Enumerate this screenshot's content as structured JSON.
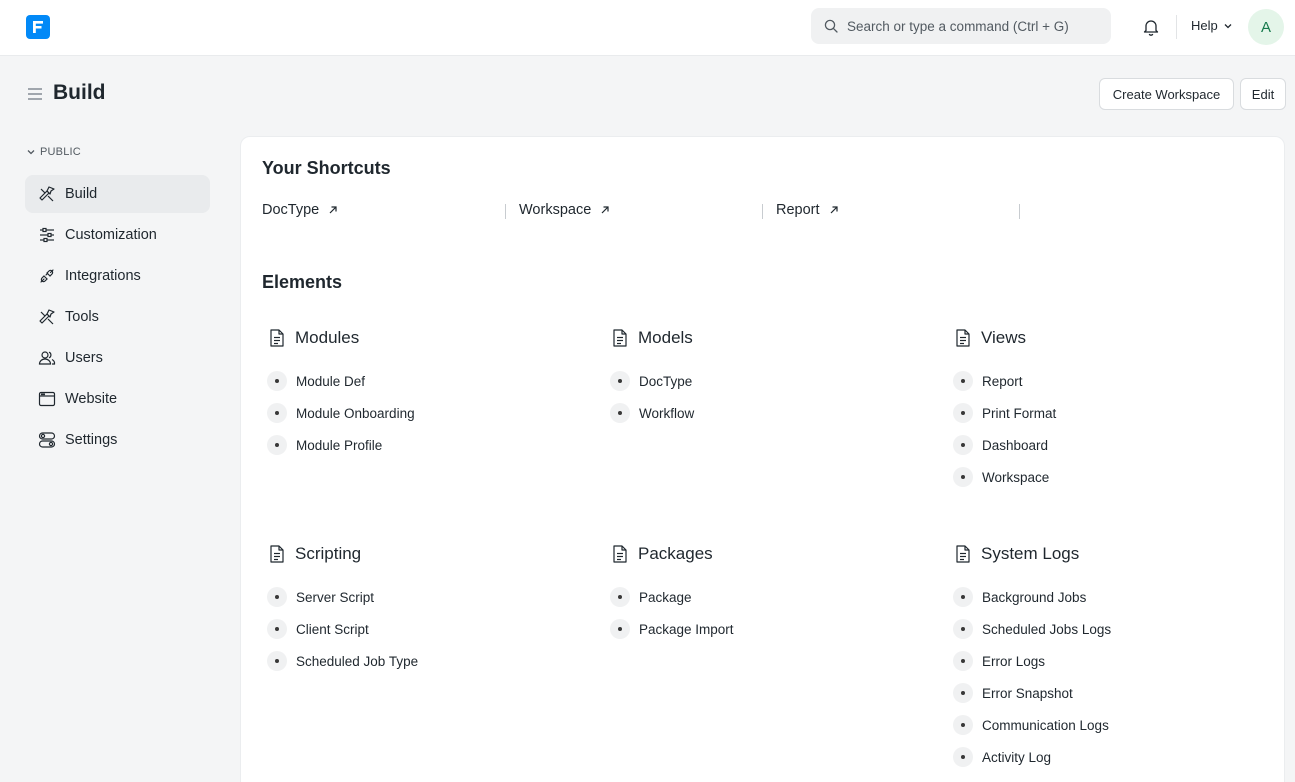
{
  "navbar": {
    "search_placeholder": "Search or type a command (Ctrl + G)",
    "help_label": "Help",
    "avatar_initial": "A"
  },
  "page": {
    "title": "Build",
    "create_workspace_label": "Create Workspace",
    "edit_label": "Edit"
  },
  "sidebar": {
    "section_label": "PUBLIC",
    "items": [
      {
        "label": "Build",
        "icon": "build-icon",
        "active": true
      },
      {
        "label": "Customization",
        "icon": "sliders-icon"
      },
      {
        "label": "Integrations",
        "icon": "plug-icon"
      },
      {
        "label": "Tools",
        "icon": "tools-icon"
      },
      {
        "label": "Users",
        "icon": "users-icon"
      },
      {
        "label": "Website",
        "icon": "browser-icon"
      },
      {
        "label": "Settings",
        "icon": "settings-toggle-icon"
      }
    ]
  },
  "shortcuts": {
    "title": "Your Shortcuts",
    "items": [
      {
        "label": "DocType"
      },
      {
        "label": "Workspace"
      },
      {
        "label": "Report"
      }
    ]
  },
  "elements": {
    "title": "Elements",
    "groups": [
      {
        "title": "Modules",
        "links": [
          "Module Def",
          "Module Onboarding",
          "Module Profile"
        ]
      },
      {
        "title": "Models",
        "links": [
          "DocType",
          "Workflow"
        ]
      },
      {
        "title": "Views",
        "links": [
          "Report",
          "Print Format",
          "Dashboard",
          "Workspace"
        ]
      },
      {
        "title": "Scripting",
        "links": [
          "Server Script",
          "Client Script",
          "Scheduled Job Type"
        ]
      },
      {
        "title": "Packages",
        "links": [
          "Package",
          "Package Import"
        ]
      },
      {
        "title": "System Logs",
        "links": [
          "Background Jobs",
          "Scheduled Jobs Logs",
          "Error Logs",
          "Error Snapshot",
          "Communication Logs",
          "Activity Log"
        ]
      }
    ]
  },
  "colors": {
    "brand": "#0289f7",
    "avatar_bg": "#e4f5e9",
    "avatar_text": "#16794c",
    "active_item_bg": "#e9ebed"
  }
}
